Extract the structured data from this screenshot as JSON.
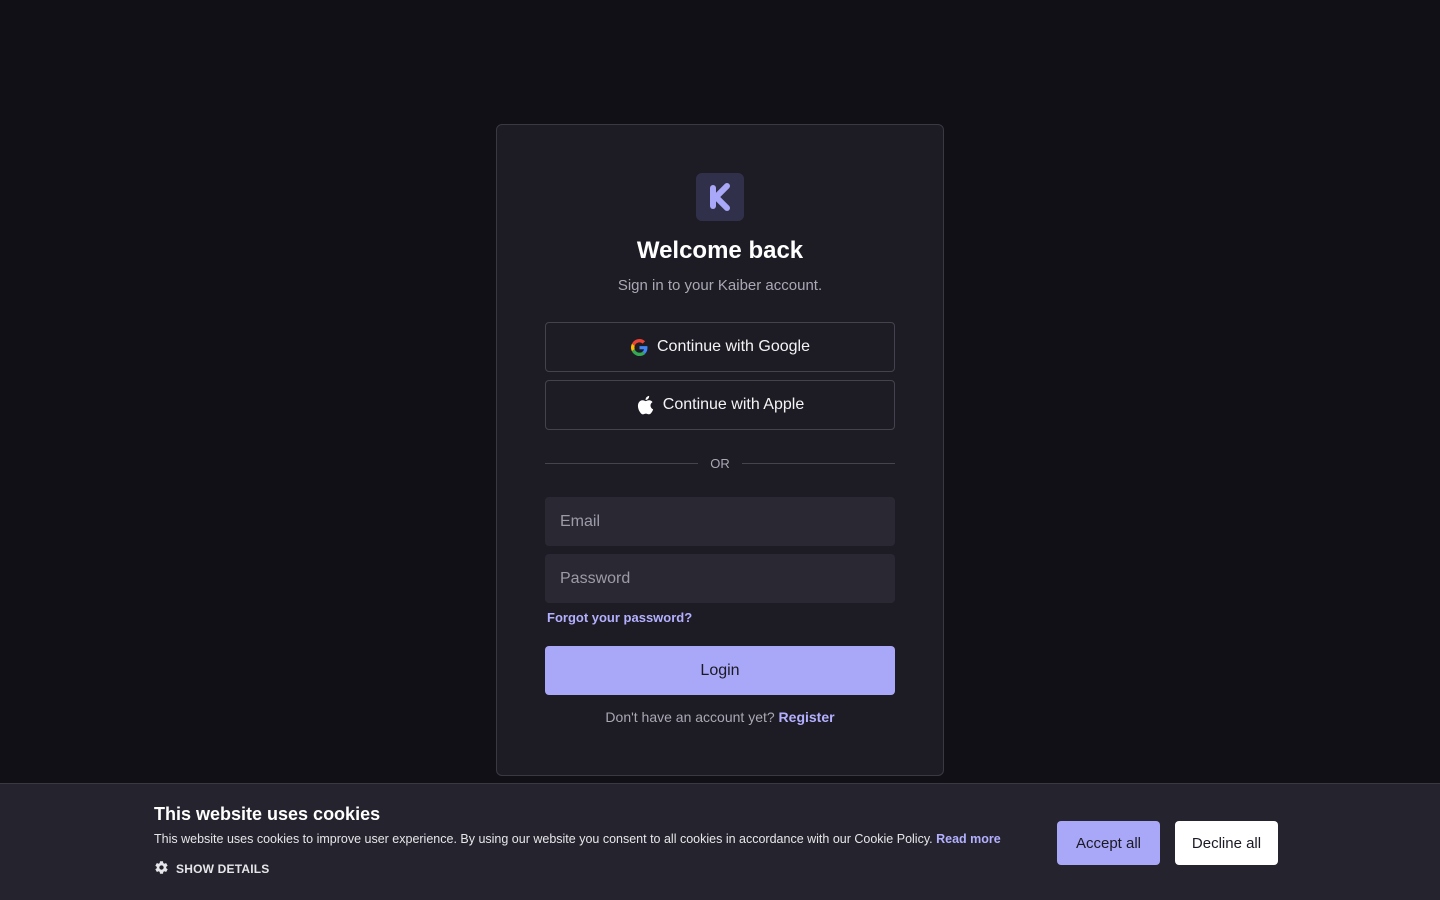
{
  "login": {
    "logo_letter": "K",
    "title": "Welcome back",
    "subtitle": "Sign in to your Kaiber account.",
    "google_label": "Continue with Google",
    "apple_label": "Continue with Apple",
    "divider_text": "OR",
    "email_placeholder": "Email",
    "password_placeholder": "Password",
    "forgot_label": "Forgot your password?",
    "login_label": "Login",
    "no_account_text": "Don't have an account yet?",
    "register_label": "Register"
  },
  "cookie": {
    "title": "This website uses cookies",
    "text": "This website uses cookies to improve user experience. By using our website you consent to all cookies in accordance with our Cookie Policy.",
    "read_more": "Read more",
    "show_details": "SHOW DETAILS",
    "accept_label": "Accept all",
    "decline_label": "Decline all"
  },
  "colors": {
    "background": "#111016",
    "card": "#1d1c24",
    "accent": "#a9a7f7",
    "link": "#b3b0ff",
    "banner": "#25242e"
  },
  "icons": [
    "kaiber-logo-icon",
    "google-icon",
    "apple-icon",
    "gear-icon"
  ]
}
